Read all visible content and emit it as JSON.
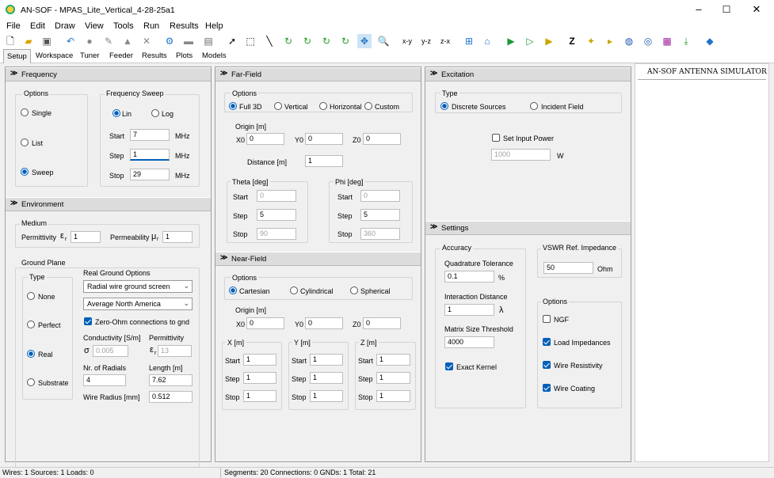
{
  "window": {
    "title": "AN-SOF - MPAS_Lite_Vertical_4-28-25a1"
  },
  "menu": [
    "File",
    "Edit",
    "Draw",
    "View",
    "Tools",
    "Run",
    "Results",
    "Help"
  ],
  "toolbar": {
    "xy": "x-y",
    "yz": "y-z",
    "zx": "z-x"
  },
  "tabs": [
    "Setup",
    "Workspace",
    "Tuner",
    "Feeder",
    "Results",
    "Plots",
    "Models"
  ],
  "frequency": {
    "header": "Frequency",
    "options_label": "Options",
    "single": "Single",
    "list": "List",
    "sweep": "Sweep",
    "sweep_label": "Frequency Sweep",
    "lin": "Lin",
    "log": "Log",
    "start_label": "Start",
    "start": "7",
    "step_label": "Step",
    "step": "1",
    "stop_label": "Stop",
    "stop": "29",
    "unit": "MHz"
  },
  "environment": {
    "header": "Environment",
    "medium": "Medium",
    "permittivity": "Permittivity",
    "eps_sym": "ε",
    "eps_sub": "r",
    "eps_val": "1",
    "permeability": "Permeability",
    "mu_sym": "μ",
    "mu_sub": "r",
    "mu_val": "1",
    "ground_plane": "Ground Plane",
    "type": "Type",
    "none": "None",
    "perfect": "Perfect",
    "real": "Real",
    "substrate": "Substrate",
    "real_ground_options": "Real Ground Options",
    "radial_select": "Radial wire ground screen",
    "soil_select": "Average North America",
    "zero_ohm": "Zero-Ohm connections to gnd",
    "conductivity": "Conductivity [S/m]",
    "sigma": "σ",
    "cond_val": "0.005",
    "permittivity2": "Permittivity",
    "eps2_val": "13",
    "nr_radials": "Nr. of Radials",
    "nr_val": "4",
    "length": "Length [m]",
    "length_val": "7.62",
    "wire_radius": "Wire Radius [mm]",
    "wire_radius_val": "0.512"
  },
  "farfield": {
    "header": "Far-Field",
    "options": "Options",
    "full3d": "Full 3D",
    "vertical": "Vertical",
    "horizontal": "Horizontal",
    "custom": "Custom",
    "origin": "Origin [m]",
    "x0": "X0",
    "x0v": "0",
    "y0": "Y0",
    "y0v": "0",
    "z0": "Z0",
    "z0v": "0",
    "distance": "Distance [m]",
    "distance_val": "1",
    "theta": "Theta [deg]",
    "phi": "Phi [deg]",
    "start": "Start",
    "step": "Step",
    "stop": "Stop",
    "th_start": "0",
    "th_step": "5",
    "th_stop": "90",
    "ph_start": "0",
    "ph_step": "5",
    "ph_stop": "360"
  },
  "nearfield": {
    "header": "Near-Field",
    "options": "Options",
    "cartesian": "Cartesian",
    "cylindrical": "Cylindrical",
    "spherical": "Spherical",
    "origin": "Origin [m]",
    "x0": "X0",
    "x0v": "0",
    "y0": "Y0",
    "y0v": "0",
    "z0": "Z0",
    "z0v": "0",
    "xm": "X [m]",
    "ym": "Y [m]",
    "zm": "Z [m]",
    "start": "Start",
    "step": "Step",
    "stop": "Stop",
    "xs": "1",
    "xst": "1",
    "xsp": "1",
    "ys": "1",
    "yst": "1",
    "ysp": "1",
    "zs": "1",
    "zst": "1",
    "zsp": "1"
  },
  "excitation": {
    "header": "Excitation",
    "type": "Type",
    "discrete": "Discrete Sources",
    "incident": "Incident Field",
    "set_input_power": "Set Input Power",
    "power_val": "1000",
    "power_unit": "W"
  },
  "settings": {
    "header": "Settings",
    "accuracy": "Accuracy",
    "quad_tol": "Quadrature Tolerance",
    "quad_val": "0.1",
    "quad_unit": "%",
    "interaction": "Interaction Distance",
    "inter_val": "1",
    "inter_unit": "λ",
    "matrix": "Matrix Size Threshold",
    "matrix_val": "4000",
    "exact_kernel": "Exact Kernel",
    "vswr": "VSWR Ref. Impedance",
    "vswr_val": "50",
    "vswr_unit": "Ohm",
    "options": "Options",
    "ngf": "NGF",
    "load_imp": "Load Impedances",
    "wire_res": "Wire Resistivity",
    "wire_coat": "Wire Coating"
  },
  "sidepanel": {
    "title": "AN-SOF ANTENNA SIMULATOR"
  },
  "status": {
    "left": "Wires: 1  Sources: 1  Loads: 0",
    "right": "Segments: 20  Connections: 0  GNDs: 1  Total: 21"
  },
  "colors": {
    "accent": "#005fb8",
    "play": "#1a9a3a"
  }
}
